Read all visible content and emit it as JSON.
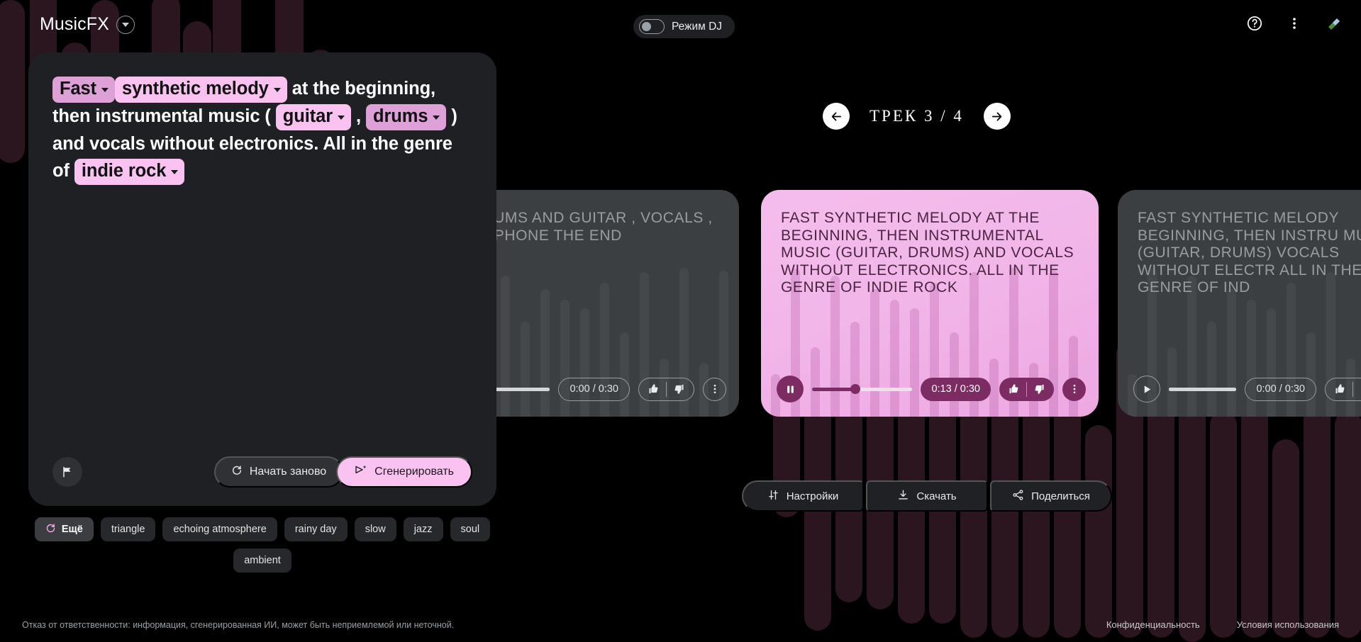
{
  "brand": {
    "name": "MusicFX",
    "caret_icon": "chevron-down-icon"
  },
  "dj_mode": {
    "label": "Режим DJ",
    "enabled": false,
    "toggle_icon": "toggle-switch-icon"
  },
  "top_right": {
    "help_icon": "help-circle-icon",
    "menu_icon": "more-vertical-icon",
    "avatar_icon": "avatar-icon"
  },
  "prompt": {
    "segments": [
      {
        "type": "chip",
        "text": "Fast",
        "style": "dark"
      },
      {
        "type": "chip",
        "text": "synthetic melody",
        "style": "light"
      },
      {
        "type": "text",
        "text": "at the beginning, then instrumental music ("
      },
      {
        "type": "chip",
        "text": "guitar",
        "style": "light"
      },
      {
        "type": "text",
        "text": ","
      },
      {
        "type": "chip",
        "text": "drums",
        "style": "dark"
      },
      {
        "type": "text",
        "text": ") and vocals without electronics. All in the genre of"
      },
      {
        "type": "chip",
        "text": "indie rock",
        "style": "light"
      }
    ],
    "flag_icon": "flag-icon",
    "restart_label": "Начать заново",
    "restart_icon": "restart-icon",
    "generate_label": "Сгенерировать",
    "generate_icon": "send-sparkle-icon"
  },
  "suggestions": {
    "more_label": "Ещё",
    "more_icon": "refresh-icon",
    "items": [
      "triangle",
      "echoing atmosphere",
      "rainy day",
      "slow",
      "jazz",
      "soul",
      "ambient"
    ]
  },
  "carousel": {
    "prev_icon": "arrow-left-icon",
    "next_icon": "arrow-right-icon",
    "counter": "ТРЕК  3 / 4",
    "current": 3,
    "total": 4
  },
  "cards": [
    {
      "id": "card-prev",
      "state": "inactive",
      "title": "IC DRUMS AND GUITAR , VOCALS , SAXOPHONE  THE END",
      "play_icon": "play-icon",
      "time": "0:00 / 0:30",
      "progress_percent": 0,
      "like_icon": "thumb-up-icon",
      "dislike_icon": "thumb-down-icon",
      "more_icon": "more-vertical-icon"
    },
    {
      "id": "card-active",
      "state": "active",
      "title": "FAST SYNTHETIC MELODY AT THE BEGINNING, THEN INSTRUMENTAL MUSIC (GUITAR, DRUMS) AND VOCALS WITHOUT ELECTRONICS. ALL IN THE GENRE OF INDIE ROCK",
      "play_icon": "pause-icon",
      "time": "0:13 / 0:30",
      "progress_percent": 43,
      "like_icon": "thumb-up-icon",
      "dislike_icon": "thumb-down-icon",
      "more_icon": "more-vertical-icon"
    },
    {
      "id": "card-next",
      "state": "inactive",
      "title": "FAST SYNTHETIC MELODY BEGINNING, THEN INSTRU MUSIC (GUITAR, DRUMS) VOCALS WITHOUT ELECTR ALL IN THE GENRE OF IND",
      "play_icon": "play-icon",
      "time": "0:00 / 0:30",
      "progress_percent": 0,
      "like_icon": "thumb-up-icon",
      "dislike_icon": "thumb-down-icon",
      "more_icon": "more-vertical-icon"
    }
  ],
  "actions": [
    {
      "label": "Настройки",
      "icon": "sliders-icon"
    },
    {
      "label": "Скачать",
      "icon": "download-icon"
    },
    {
      "label": "Поделиться",
      "icon": "share-icon"
    }
  ],
  "footer": {
    "disclaimer": "Отказ от ответственности: информация, сгенерированная ИИ, может быть неприемлемой или неточной.",
    "links": [
      "Конфиденциальность",
      "Условия использования"
    ]
  },
  "colors": {
    "accent_pink": "#f9c2f0",
    "chip_dark": "#dda1d8",
    "card_active_bg": "#f2b6e9",
    "control_plum": "#7c2b63",
    "panel_bg": "#1e2023",
    "page_bg": "#000000",
    "wave_bg": "#2b1620"
  }
}
